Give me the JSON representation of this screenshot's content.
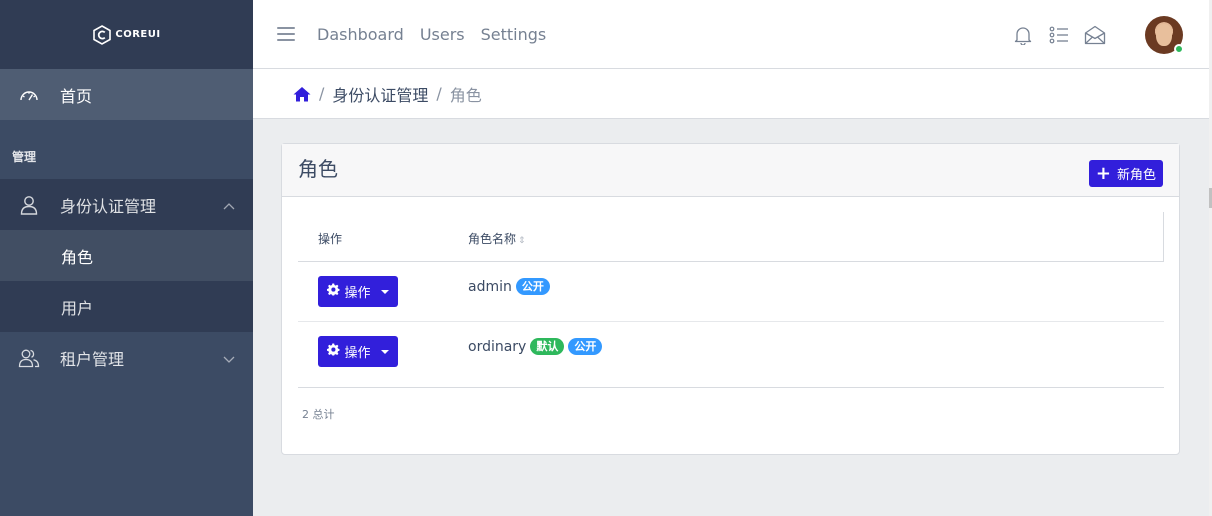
{
  "brand": {
    "text": "COREUI"
  },
  "sidebar": {
    "home_label": "首页",
    "section_title": "管理",
    "groups": [
      {
        "label": "身份认证管理",
        "expanded": true,
        "items": [
          {
            "label": "角色",
            "active": true
          },
          {
            "label": "用户",
            "active": false
          }
        ]
      },
      {
        "label": "租户管理",
        "expanded": false
      }
    ]
  },
  "header": {
    "links": [
      "Dashboard",
      "Users",
      "Settings"
    ],
    "icons": [
      "bell-icon",
      "list-icon",
      "envelope-open-icon"
    ]
  },
  "breadcrumb": {
    "items": [
      "身份认证管理",
      "角色"
    ]
  },
  "card": {
    "title": "角色",
    "new_button": "新角色",
    "columns": {
      "actions": "操作",
      "name": "角色名称"
    },
    "action_label": "操作",
    "rows": [
      {
        "name": "admin",
        "badges": [
          {
            "text": "公开",
            "color": "#3399ff"
          }
        ]
      },
      {
        "name": "ordinary",
        "badges": [
          {
            "text": "默认",
            "color": "#2eb85c"
          },
          {
            "text": "公开",
            "color": "#3399ff"
          }
        ]
      }
    ],
    "total_text": "2 总计"
  },
  "colors": {
    "primary": "#321fdb",
    "sidebar": "#3c4b64",
    "info": "#3399ff",
    "success": "#2eb85c"
  }
}
